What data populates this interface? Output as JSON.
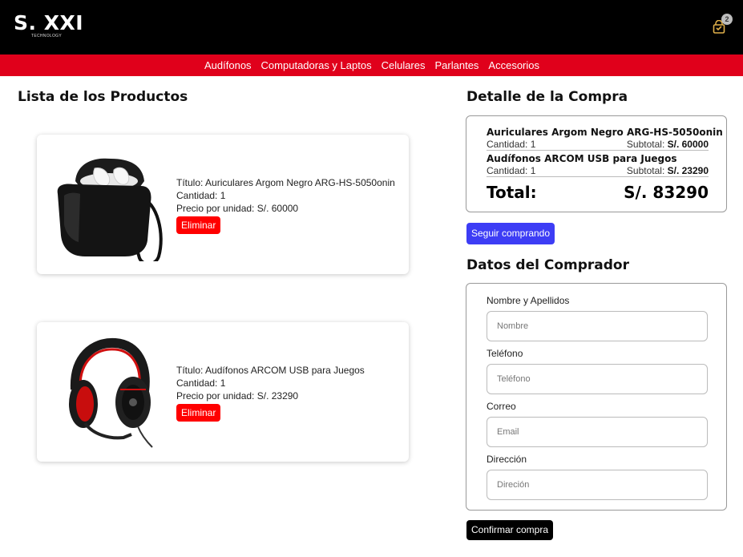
{
  "brand": {
    "name": "S. XXI",
    "tagline": "TECHNOLOGY"
  },
  "cart": {
    "icon": "cart-icon",
    "count": "2",
    "accent": "#e0b04a"
  },
  "nav": {
    "items": [
      {
        "label": "Audífonos"
      },
      {
        "label": "Computadoras y Laptos"
      },
      {
        "label": "Celulares"
      },
      {
        "label": "Parlantes"
      },
      {
        "label": "Accesorios"
      }
    ],
    "color": "#e0001b"
  },
  "products": {
    "heading": "Lista de los Productos",
    "items": [
      {
        "image": "earbuds-case-image",
        "title": "Título: Auriculares Argom Negro ARG-HS-5050onin",
        "quantity": "Cantidad: 1",
        "price": "Precio por unidad: S/. 60000",
        "remove_label": "Eliminar"
      },
      {
        "image": "headset-image",
        "title": "Título: Audífonos ARCOM USB para Juegos",
        "quantity": "Cantidad: 1",
        "price": "Precio por unidad: S/. 23290",
        "remove_label": "Eliminar"
      }
    ]
  },
  "detail": {
    "heading": "Detalle de la Compra",
    "items": [
      {
        "name": "Auriculares Argom Negro ARG-HS-5050onin",
        "quantity": "Cantidad: 1",
        "subtotal_label": "Subtotal:",
        "subtotal_value": "S/. 60000"
      },
      {
        "name": "Audífonos ARCOM USB para Juegos",
        "quantity": "Cantidad: 1",
        "subtotal_label": "Subtotal:",
        "subtotal_value": "S/. 23290"
      }
    ],
    "total_label": "Total:",
    "total_value": "S/. 83290",
    "continue_label": "Seguir comprando"
  },
  "buyer": {
    "heading": "Datos del Comprador",
    "fields": [
      {
        "label": "Nombre y Apellidos",
        "placeholder": "Nombre",
        "value": ""
      },
      {
        "label": "Teléfono",
        "placeholder": "Teléfono",
        "value": ""
      },
      {
        "label": "Correo",
        "placeholder": "Email",
        "value": ""
      },
      {
        "label": "Dirección",
        "placeholder": "Direción",
        "value": ""
      }
    ],
    "confirm_label": "Confirmar compra"
  },
  "colors": {
    "remove": "#ff0000",
    "continue": "#3d3df5",
    "confirm": "#000000"
  }
}
